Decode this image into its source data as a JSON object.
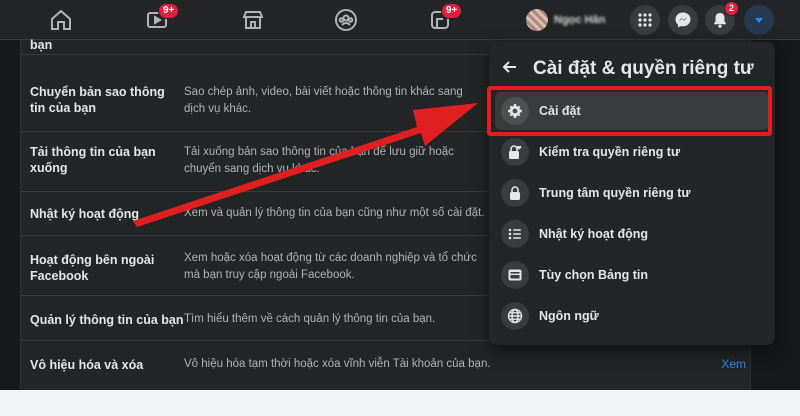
{
  "navbar": {
    "icons": [
      {
        "name": "home-icon"
      },
      {
        "name": "watch-icon",
        "badge": "9+"
      },
      {
        "name": "marketplace-icon"
      },
      {
        "name": "groups-icon"
      },
      {
        "name": "gaming-icon",
        "badge": "9+"
      }
    ],
    "profile_name": "Ngọc Hân",
    "menu_icon": "apps-grid-icon",
    "messenger_icon": "messenger-icon",
    "notifications_badge": "2",
    "account_icon": "caret-down-icon"
  },
  "settings_list": {
    "rows": [
      {
        "title": "bạn",
        "desc": "",
        "action": ""
      },
      {
        "title": "Chuyển bản sao thông tin của bạn",
        "desc": "Sao chép ảnh, video, bài viết hoặc thông tin khác sang dịch vụ khác.",
        "action": ""
      },
      {
        "title": "Tải thông tin của bạn xuống",
        "desc": "Tải xuống bản sao thông tin của bạn để lưu giữ hoặc chuyển sang dịch vụ khác.",
        "action": ""
      },
      {
        "title": "Nhật ký hoạt động",
        "desc": "Xem và quản lý thông tin của bạn cũng như một số cài đặt.",
        "action": ""
      },
      {
        "title": "Hoạt động bên ngoài Facebook",
        "desc": "Xem hoặc xóa hoạt động từ các doanh nghiệp và tổ chức mà bạn truy cập ngoài Facebook.",
        "action": ""
      },
      {
        "title": "Quản lý thông tin của bạn",
        "desc": "Tìm hiểu thêm về cách quản lý thông tin của bạn.",
        "action": ""
      },
      {
        "title": "Vô hiệu hóa và xóa",
        "desc": "Vô hiệu hóa tạm thời hoặc xóa vĩnh viễn Tài khoản của bạn.",
        "action": "Xem"
      }
    ]
  },
  "dropdown": {
    "back_icon": "arrow-left-icon",
    "title": "Cài đặt & quyền riêng tư",
    "items": [
      {
        "label": "Cài đặt",
        "icon": "gear-icon"
      },
      {
        "label": "Kiểm tra quyền riêng tư",
        "icon": "lock-heart-icon"
      },
      {
        "label": "Trung tâm quyền riêng tư",
        "icon": "lock-icon"
      },
      {
        "label": "Nhật ký hoạt động",
        "icon": "list-icon"
      },
      {
        "label": "Tùy chọn Bảng tin",
        "icon": "news-feed-icon"
      },
      {
        "label": "Ngôn ngữ",
        "icon": "globe-icon"
      }
    ]
  },
  "colors": {
    "highlight": "#e02020",
    "accent": "#2d88ff",
    "badge": "#e41e3f"
  }
}
